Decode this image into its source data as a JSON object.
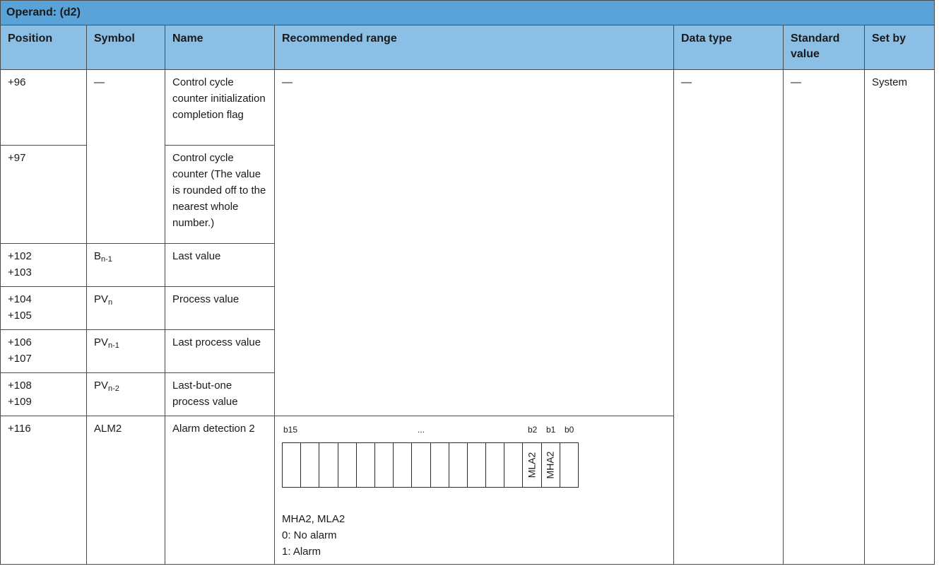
{
  "operand_title": "Operand: (d2)",
  "headers": {
    "position": "Position",
    "symbol": "Symbol",
    "name": "Name",
    "recommended_range": "Recommended range",
    "data_type": "Data type",
    "standard_value": "Standard value",
    "set_by": "Set by"
  },
  "dash": "—",
  "set_by_value": "System",
  "rows": {
    "r96": {
      "position": "+96",
      "symbol": "—",
      "name": "Control cycle counter initialization completion flag",
      "range": "—",
      "data_type": "—",
      "standard": "—"
    },
    "r97": {
      "position": "+97",
      "name": "Control cycle counter (The value is rounded off to the nearest whole number.)"
    },
    "r102": {
      "position_a": "+102",
      "position_b": "+103",
      "symbol_base": "B",
      "symbol_sub": "n-1",
      "name": "Last value"
    },
    "r104": {
      "position_a": "+104",
      "position_b": "+105",
      "symbol_base": "PV",
      "symbol_sub": "n",
      "name": "Process value"
    },
    "r106": {
      "position_a": "+106",
      "position_b": "+107",
      "symbol_base": "PV",
      "symbol_sub": "n-1",
      "name": "Last process value"
    },
    "r108": {
      "position_a": "+108",
      "position_b": "+109",
      "symbol_base": "PV",
      "symbol_sub": "n-2",
      "name": "Last-but-one process value"
    },
    "r116": {
      "position": "+116",
      "symbol": "ALM2",
      "name": "Alarm detection 2",
      "bit_labels": {
        "b15": "b15",
        "dots": "...",
        "b2": "b2",
        "b1": "b1",
        "b0": "b0"
      },
      "bits": {
        "b2": "MLA2",
        "b1": "MHA2"
      },
      "notes": [
        "MHA2, MLA2",
        "0: No alarm",
        "1: Alarm"
      ]
    }
  }
}
